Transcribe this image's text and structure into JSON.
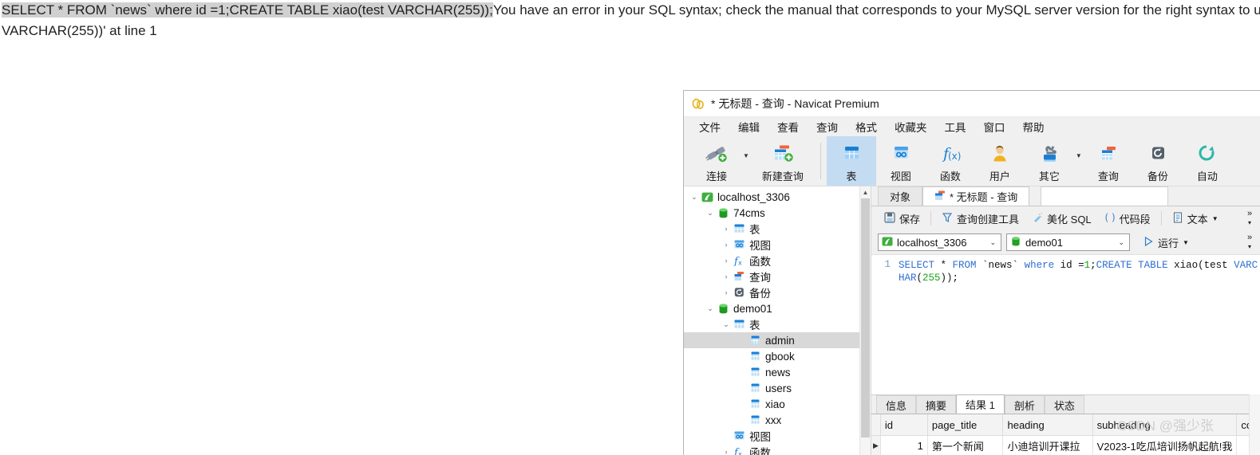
{
  "error_page": {
    "selected_sql": "SELECT * FROM `news` where id =1;CREATE TABLE xiao(test VARCHAR(255));",
    "line1_rest": "You have an error in your SQL syntax; check the manual that corresponds to your MySQL server version for the right syntax to use",
    "line2": "VARCHAR(255))' at line 1"
  },
  "window": {
    "title": "* 无标题 - 查询 - Navicat Premium",
    "logo_icon": "navicat-logo-icon"
  },
  "menubar": {
    "items": [
      {
        "label": "文件"
      },
      {
        "label": "编辑"
      },
      {
        "label": "查看"
      },
      {
        "label": "查询"
      },
      {
        "label": "格式"
      },
      {
        "label": "收藏夹"
      },
      {
        "label": "工具"
      },
      {
        "label": "窗口"
      },
      {
        "label": "帮助"
      }
    ]
  },
  "toolbar": {
    "items": [
      {
        "label": "连接",
        "icon": "connection-icon",
        "caret": true,
        "selected": false,
        "wide": false
      },
      {
        "label": "新建查询",
        "icon": "new-query-icon",
        "caret": false,
        "selected": false,
        "wide": true
      },
      {
        "label": "表",
        "icon": "table-icon",
        "caret": false,
        "selected": true,
        "wide": false
      },
      {
        "label": "视图",
        "icon": "view-icon",
        "caret": false,
        "selected": false,
        "wide": false
      },
      {
        "label": "函数",
        "icon": "function-icon",
        "caret": false,
        "selected": false,
        "wide": false
      },
      {
        "label": "用户",
        "icon": "user-icon",
        "caret": false,
        "selected": false,
        "wide": false
      },
      {
        "label": "其它",
        "icon": "other-tools-icon",
        "caret": true,
        "selected": false,
        "wide": false
      },
      {
        "label": "查询",
        "icon": "query-icon",
        "caret": false,
        "selected": false,
        "wide": false
      },
      {
        "label": "备份",
        "icon": "backup-icon",
        "caret": false,
        "selected": false,
        "wide": false
      },
      {
        "label": "自动",
        "icon": "automation-icon",
        "caret": false,
        "selected": false,
        "wide": false
      }
    ]
  },
  "sidebar": {
    "tree": [
      {
        "label": "localhost_3306",
        "icon": "connection-host-icon",
        "indent": 0,
        "twisty": "down",
        "selected": false
      },
      {
        "label": "74cms",
        "icon": "database-icon",
        "indent": 1,
        "twisty": "down",
        "selected": false
      },
      {
        "label": "表",
        "icon": "table-icon",
        "indent": 2,
        "twisty": "right",
        "selected": false
      },
      {
        "label": "视图",
        "icon": "view-icon",
        "indent": 2,
        "twisty": "right",
        "selected": false
      },
      {
        "label": "函数",
        "icon": "function-icon",
        "indent": 2,
        "twisty": "right",
        "selected": false
      },
      {
        "label": "查询",
        "icon": "query-icon",
        "indent": 2,
        "twisty": "right",
        "selected": false
      },
      {
        "label": "备份",
        "icon": "backup-icon",
        "indent": 2,
        "twisty": "right",
        "selected": false
      },
      {
        "label": "demo01",
        "icon": "database-icon",
        "indent": 1,
        "twisty": "down",
        "selected": false
      },
      {
        "label": "表",
        "icon": "table-icon",
        "indent": 2,
        "twisty": "down",
        "selected": false
      },
      {
        "label": "admin",
        "icon": "table-item-icon",
        "indent": 3,
        "twisty": "none",
        "selected": true
      },
      {
        "label": "gbook",
        "icon": "table-item-icon",
        "indent": 3,
        "twisty": "none",
        "selected": false
      },
      {
        "label": "news",
        "icon": "table-item-icon",
        "indent": 3,
        "twisty": "none",
        "selected": false
      },
      {
        "label": "users",
        "icon": "table-item-icon",
        "indent": 3,
        "twisty": "none",
        "selected": false
      },
      {
        "label": "xiao",
        "icon": "table-item-icon",
        "indent": 3,
        "twisty": "none",
        "selected": false
      },
      {
        "label": "xxx",
        "icon": "table-item-icon",
        "indent": 3,
        "twisty": "none",
        "selected": false
      },
      {
        "label": "视图",
        "icon": "view-icon",
        "indent": 2,
        "twisty": "none",
        "selected": false
      },
      {
        "label": "函数",
        "icon": "function-icon",
        "indent": 2,
        "twisty": "right",
        "selected": false
      }
    ]
  },
  "doc_tabs": [
    {
      "label": "对象",
      "icon": "",
      "active": false
    },
    {
      "label": "* 无标题 - 查询",
      "icon": "query-icon",
      "active": true
    }
  ],
  "query_toolbar": {
    "buttons": [
      {
        "label": "保存",
        "icon": "save-icon"
      },
      {
        "label": "查询创建工具",
        "icon": "query-builder-icon"
      },
      {
        "label": "美化 SQL",
        "icon": "beautify-icon"
      },
      {
        "label": "代码段",
        "icon": "snippet-icon"
      },
      {
        "label": "文本",
        "icon": "text-icon",
        "caret": true
      }
    ],
    "overflow_icon": "»",
    "dropdown_icon": "▾"
  },
  "connection_bar": {
    "connection": {
      "value": "localhost_3306",
      "icon": "connection-host-icon"
    },
    "database": {
      "value": "demo01",
      "icon": "database-icon"
    },
    "run_button": {
      "label": "运行",
      "icon": "run-icon",
      "caret": true
    }
  },
  "editor": {
    "line_number": "1",
    "tokens": [
      {
        "t": "SELECT",
        "c": "kw"
      },
      {
        "t": " * ",
        "c": "plain"
      },
      {
        "t": "FROM",
        "c": "kw"
      },
      {
        "t": " `news` ",
        "c": "plain"
      },
      {
        "t": "where",
        "c": "kw"
      },
      {
        "t": " id =",
        "c": "plain"
      },
      {
        "t": "1",
        "c": "num"
      },
      {
        "t": ";",
        "c": "plain"
      },
      {
        "t": "CREATE TABLE",
        "c": "kw"
      },
      {
        "t": " xiao(test ",
        "c": "plain"
      },
      {
        "t": "VARCHAR",
        "c": "kw"
      },
      {
        "t": "(",
        "c": "plain"
      },
      {
        "t": "255",
        "c": "num"
      },
      {
        "t": "));",
        "c": "plain"
      }
    ]
  },
  "result_tabs": [
    {
      "label": "信息",
      "active": false
    },
    {
      "label": "摘要",
      "active": false
    },
    {
      "label": "结果 1",
      "active": true
    },
    {
      "label": "剖析",
      "active": false
    },
    {
      "label": "状态",
      "active": false
    }
  ],
  "result_grid": {
    "columns": [
      "id",
      "page_title",
      "heading",
      "subheading",
      "cc"
    ],
    "rows": [
      {
        "id": "1",
        "page_title": "第一个新闻",
        "heading": "小迪培训开课拉",
        "subheading": "V2023-1吃瓜培训扬帆起航!我",
        "cc": ""
      }
    ]
  },
  "watermark": "CSDN @强少张",
  "colors": {
    "accent_blue": "#1a7fd4",
    "selected_toolbar_bg": "#c3dcf2",
    "selected_row_bg": "#d8d8d8",
    "keyword": "#2f6fd0",
    "number": "#17a317",
    "gutter": "#7f9bbf"
  }
}
